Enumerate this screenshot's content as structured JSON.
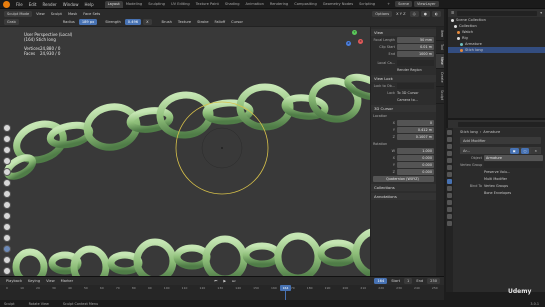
{
  "topbar": {
    "menus": [
      "File",
      "Edit",
      "Render",
      "Window",
      "Help"
    ],
    "workspaces": [
      "Layout",
      "Modeling",
      "Sculpting",
      "UV Editing",
      "Texture Paint",
      "Shading",
      "Animation",
      "Rendering",
      "Compositing",
      "Geometry Nodes",
      "Scripting"
    ],
    "active_workspace": "Layout",
    "scene": "Scene",
    "view_layer": "ViewLayer"
  },
  "viewport_header": {
    "mode": "Sculpt Mode",
    "menus": [
      "View",
      "Sculpt",
      "Mask",
      "Face Sets"
    ],
    "brush": "Grab",
    "radius_label": "Radius",
    "radius_value": "189 px",
    "strength_label": "Strength",
    "strength_value": "0.496",
    "row2": [
      "Brush",
      "Texture",
      "Stroke",
      "Falloff",
      "Cursor"
    ],
    "options": [
      "Options"
    ],
    "symmetry": "X Y Z"
  },
  "viewport": {
    "view_name": "User Perspective (Local)",
    "object_name": "(164) Stich long",
    "stats": [
      {
        "label": "Vertices",
        "value": "24,880 / 0"
      },
      {
        "label": "Faces",
        "value": "24,930 / 0"
      }
    ],
    "gizmo": {
      "x": "X",
      "y": "Y",
      "z": "Z"
    }
  },
  "npanel": {
    "tabs": [
      "Item",
      "Tool",
      "View",
      "Create",
      "Sculpt"
    ],
    "active_tab": "View",
    "view_header": "View",
    "focal_label": "Focal Length",
    "focal_value": "50 mm",
    "clip_start_label": "Clip Start",
    "clip_start_value": "0.01 m",
    "end_label": "End",
    "end_value": "1000 m",
    "local_camera_label": "Local Ca...",
    "render_region": "Render Region",
    "view_lock_header": "View Lock",
    "lock_to_object_label": "Lock to Ob...",
    "lock_label": "Lock",
    "lock_3d_cursor": "To 3D Cursor",
    "camera_to_view": "Camera to...",
    "cursor_header": "3D Cursor",
    "location_label": "Location",
    "loc_x": "0",
    "loc_y": "0.412 m",
    "loc_z": "0.1007 m",
    "rotation_label": "Rotation",
    "rot_w": "1.000",
    "rot_x": "0.000",
    "rot_y": "0.000",
    "rot_z": "0.000",
    "rot_mode": "Quaternion (WXYZ)",
    "collections_header": "Collections",
    "annotations_header": "Annotations"
  },
  "outliner": {
    "root": "Scene Collection",
    "items": [
      {
        "name": "Collection",
        "selected": false
      },
      {
        "name": "Watch",
        "selected": false
      },
      {
        "name": "Rig",
        "selected": false
      },
      {
        "name": "Armature",
        "selected": false
      },
      {
        "name": "Stich long",
        "selected": true
      }
    ]
  },
  "properties": {
    "object": "Stich long",
    "armature": "Armature",
    "add_modifier": "Add Modifier",
    "modifier_name": "Ar...",
    "object_label": "Object",
    "object_value": "Armature",
    "vertex_group_label": "Vertex Group",
    "preserve_volume": "Preserve Volu...",
    "multi_modifier": "Multi Modifier",
    "bind_to_label": "Bind To",
    "vertex_groups": "Vertex Groups",
    "bone_envelopes": "Bone Envelopes"
  },
  "timeline": {
    "menus": [
      "Playback",
      "Keying",
      "View",
      "Marker"
    ],
    "current_frame": "164",
    "start_label": "Start",
    "start_value": "1",
    "end_label": "End",
    "end_value": "250",
    "ticks": [
      "0",
      "10",
      "20",
      "30",
      "40",
      "50",
      "60",
      "70",
      "80",
      "90",
      "100",
      "110",
      "120",
      "130",
      "140",
      "150",
      "160",
      "170",
      "180",
      "190",
      "200",
      "210",
      "220",
      "230",
      "240",
      "250"
    ]
  },
  "statusbar": {
    "items": [
      "Sculpt",
      "Rotate View",
      "Sculpt Context Menu"
    ],
    "version": "3.0.1"
  },
  "watermark": "Udemy",
  "colors": {
    "accent": "#4772b3",
    "chain": "#9fcf8f",
    "brush_circle": "#d7c14a"
  }
}
